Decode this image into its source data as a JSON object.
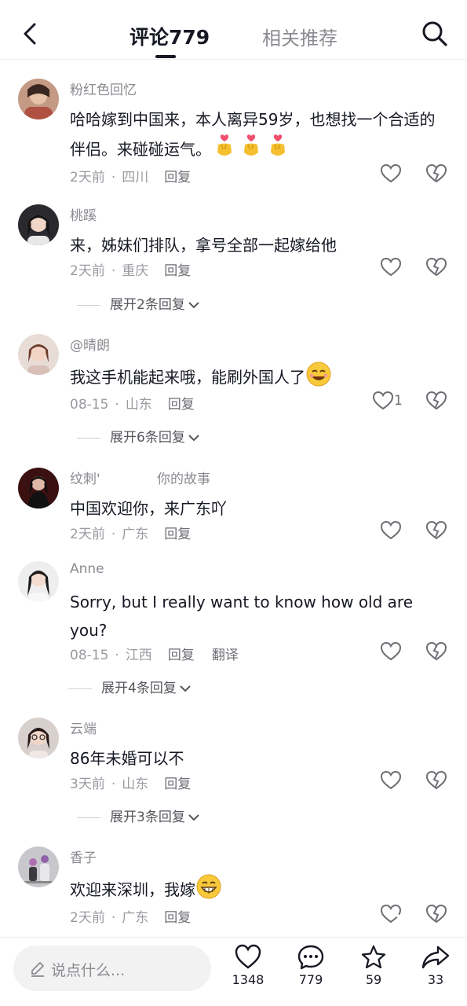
{
  "header": {
    "tab_active": "评论779",
    "tab_other": "相关推荐"
  },
  "comments": [
    {
      "username": "粉红色回忆",
      "text": "哈哈嫁到中国来，本人离异59岁，也想找一个合适的伴侣。来碰碰运气。",
      "emojis": [
        "finger-heart",
        "finger-heart",
        "finger-heart"
      ],
      "time": "2天前",
      "location": "四川",
      "reply": "回复"
    },
    {
      "username": "桃蹊",
      "text": "来，姊妹们排队，拿号全部一起嫁给他",
      "time": "2天前",
      "location": "重庆",
      "reply": "回复",
      "expand": "展开2条回复"
    },
    {
      "username": "@晴朗",
      "text": "我这手机能起来哦，能刷外国人了",
      "emojis": [
        "smile-face"
      ],
      "time": "08-15",
      "location": "山东",
      "reply": "回复",
      "likes": "1",
      "expand": "展开6条回复"
    },
    {
      "username": "纹刺'",
      "username_extra": "你的故事",
      "text": "中国欢迎你，来广东吖",
      "time": "2天前",
      "location": "广东",
      "reply": "回复"
    },
    {
      "username": "Anne",
      "text": "Sorry, but I really want to know how old are you?",
      "time": "08-15",
      "location": "江西",
      "reply": "回复",
      "translate": "翻译",
      "expand": "展开4条回复"
    },
    {
      "username": "云端",
      "text": "86年未婚可以不",
      "time": "3天前",
      "location": "山东",
      "reply": "回复",
      "expand": "展开3条回复"
    },
    {
      "username": "香子",
      "text": "欢迎来深圳，我嫁",
      "emojis": [
        "grin-face"
      ],
      "time": "2天前",
      "location": "广东",
      "reply": "回复"
    }
  ],
  "meta_dot": "·",
  "bottom": {
    "placeholder": "说点什么...",
    "like_count": "1348",
    "comment_count": "779",
    "favorite_count": "59",
    "share_count": "33"
  },
  "colors": {
    "text": "#161823",
    "secondary": "#8a8b91",
    "icon": "#6d6e74"
  }
}
